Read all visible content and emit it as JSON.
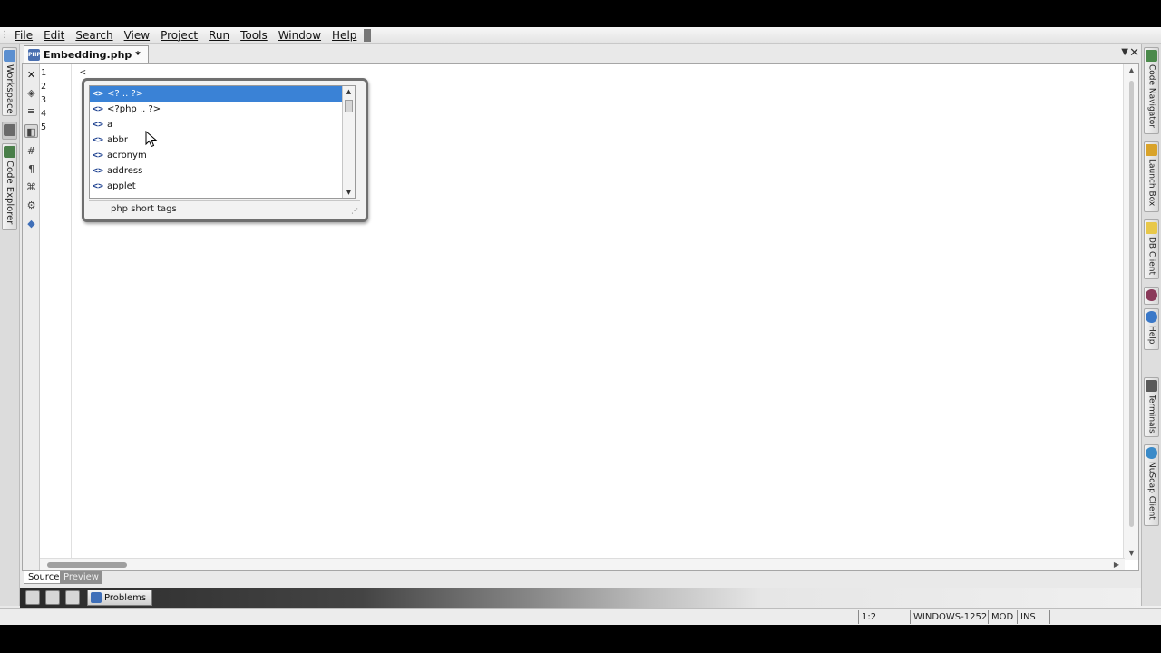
{
  "menubar": {
    "items": [
      "File",
      "Edit",
      "Search",
      "View",
      "Project",
      "Run",
      "Tools",
      "Window",
      "Help"
    ]
  },
  "left_panels": [
    {
      "label": "Workspace",
      "icon": "workspace-icon"
    },
    {
      "label": "Code Explorer",
      "icon": "code-explorer-icon"
    }
  ],
  "editor": {
    "tab_label": "Embedding.php *",
    "tab_icon_text": "PHP",
    "line_numbers": [
      "1",
      "2",
      "3",
      "4",
      "5"
    ],
    "code_text": "<"
  },
  "autocomplete": {
    "items": [
      {
        "label": "<? .. ?>",
        "selected": true
      },
      {
        "label": "<?php .. ?>",
        "selected": false
      },
      {
        "label": "a",
        "selected": false
      },
      {
        "label": "abbr",
        "selected": false
      },
      {
        "label": "acronym",
        "selected": false
      },
      {
        "label": "address",
        "selected": false
      },
      {
        "label": "applet",
        "selected": false
      }
    ],
    "item_icon": "<>",
    "footer_text": "php short tags"
  },
  "view_tabs": {
    "source": "Source",
    "preview": "Preview"
  },
  "bottom_panel": {
    "problems_label": "Problems"
  },
  "statusbar": {
    "position": "1:2",
    "encoding": "WINDOWS-1252",
    "modified": "MOD",
    "insert_mode": "INS"
  },
  "right_panels": [
    {
      "label": "Code Navigator",
      "icon": "code-navigator-icon"
    },
    {
      "label": "Launch Box",
      "icon": "launch-box-icon"
    },
    {
      "label": "DB Client",
      "icon": "db-client-icon"
    },
    {
      "label": "",
      "icon": "f-icon"
    },
    {
      "label": "Help",
      "icon": "help-icon"
    },
    {
      "label": "Terminals",
      "icon": "terminals-icon"
    },
    {
      "label": "NuSoap Client",
      "icon": "nusoap-client-icon"
    }
  ],
  "colors": {
    "selection": "#3a82d6",
    "tag_icon": "#1b3f8f"
  }
}
